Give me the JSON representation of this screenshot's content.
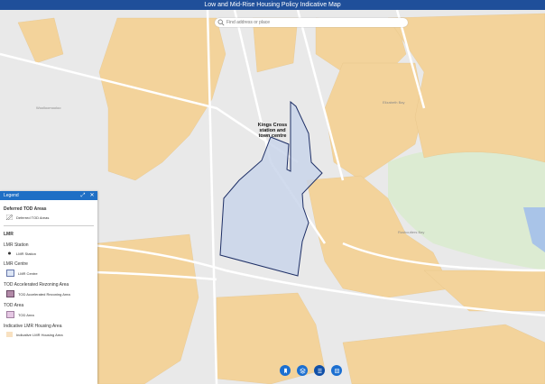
{
  "header": {
    "title": "Low and Mid-Rise Housing Policy Indicative Map"
  },
  "search": {
    "placeholder": "Find address or place"
  },
  "map": {
    "labels": {
      "woolloomooloo": "Woolloomooloo",
      "elizabeth_bay": "Elizabeth Bay",
      "rushcutters_bay": "Rushcutters Bay",
      "kings_cross": "Kings Cross station and town centre"
    },
    "colors": {
      "lmr_housing": "#f3d39b",
      "tod_area": "#c9d5ea",
      "tod_border": "#1e2f66",
      "park": "#dcebd2",
      "water": "#a9c4e8"
    }
  },
  "legend": {
    "title": "Legend",
    "sections": {
      "deferred": {
        "title": "Deferred TOD Areas",
        "item": "Deferred TOD Areas"
      },
      "lmr": {
        "title": "LMR",
        "station": {
          "title": "LMR Station",
          "item": "LMR Station"
        },
        "centre": {
          "title": "LMR Centre",
          "item": "LMR Centre"
        },
        "tod_accel": {
          "title": "TOD Accelerated Rezoning Area",
          "item": "TOD Accelerated Rezoning Area"
        },
        "tod_area": {
          "title": "TOD Area",
          "item": "TOD Area"
        },
        "indicative": {
          "title": "Indicative LMR Housing Area",
          "item": "Indicative LMR Housing Area"
        }
      }
    }
  },
  "toolbar": {
    "icons": [
      "bookmark-icon",
      "layers-icon",
      "list-icon",
      "basemap-icon"
    ]
  }
}
